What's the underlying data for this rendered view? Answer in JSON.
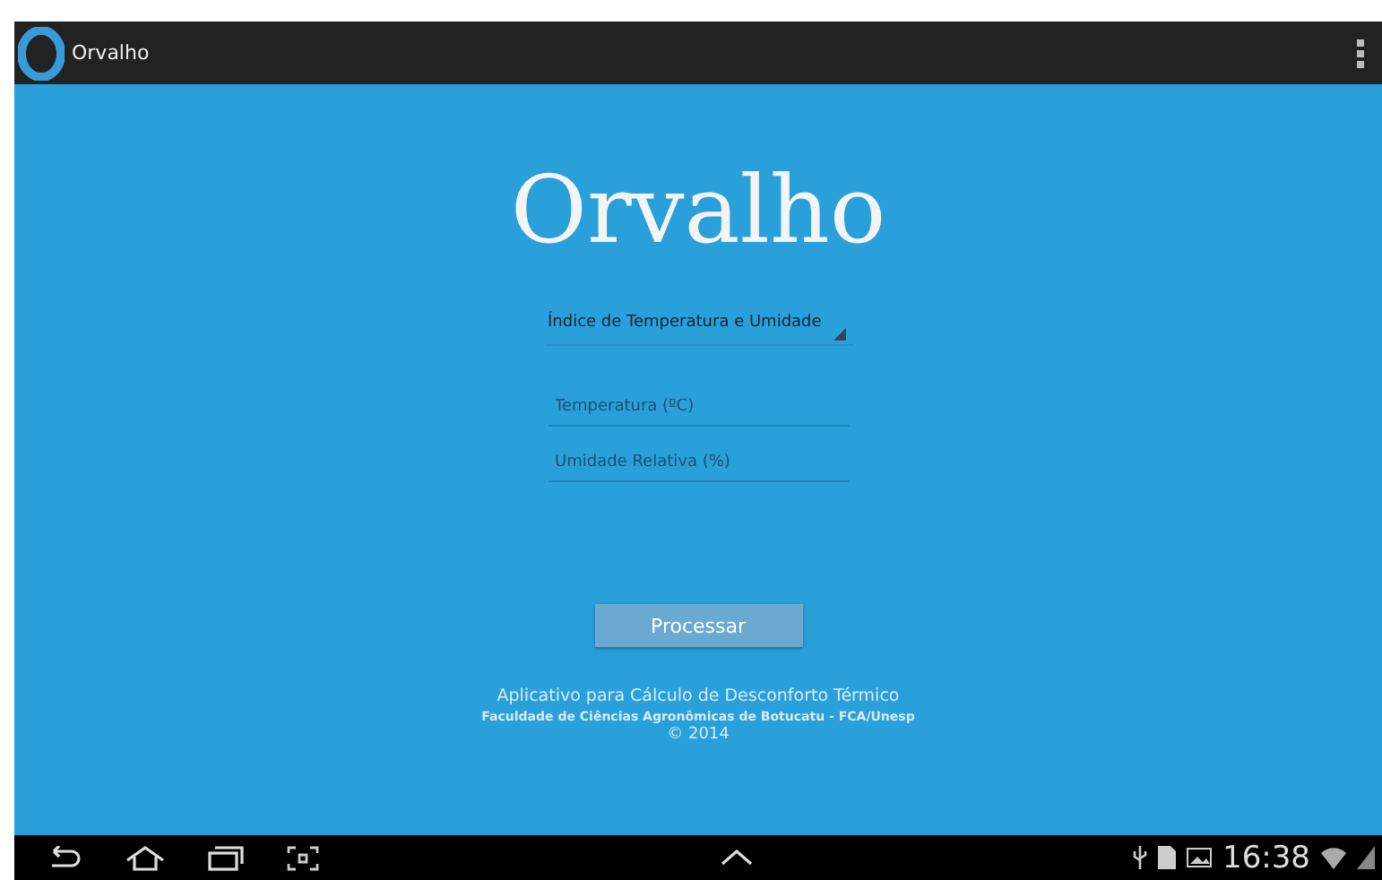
{
  "action_bar": {
    "title": "Orvalho"
  },
  "logo": {
    "text": "Orvalho"
  },
  "spinner": {
    "value": "Índice de Temperatura e Umidade"
  },
  "fields": [
    {
      "placeholder": "Temperatura (ºC)"
    },
    {
      "placeholder": "Umidade Relativa (%)"
    }
  ],
  "button": {
    "label": "Processar"
  },
  "footer": {
    "line1": "Aplicativo para Cálculo de Desconforto Térmico",
    "line2": "Faculdade de Ciências Agronômicas de Botucatu - FCA/Unesp",
    "line3": "© 2014"
  },
  "status_bar": {
    "time": "16:38"
  }
}
